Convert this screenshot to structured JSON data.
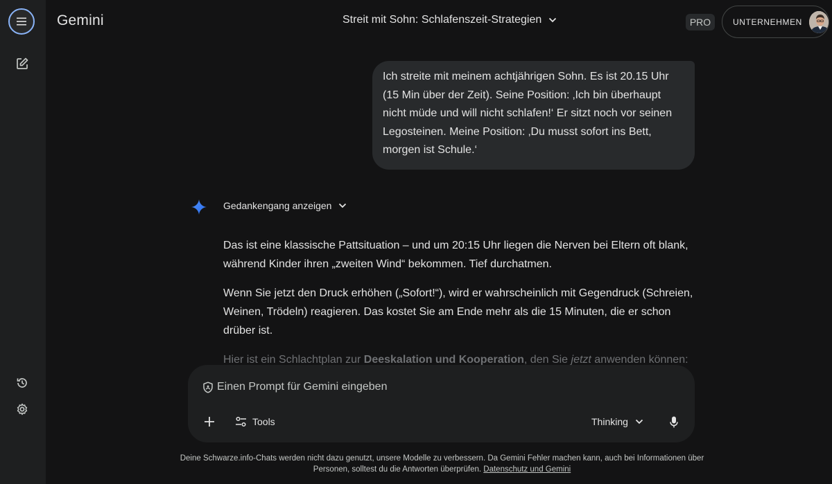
{
  "app": {
    "brand": "Gemini"
  },
  "header": {
    "chat_title": "Streit mit Sohn: Schlafenszeit-Strategien",
    "pro_badge": "PRO",
    "account_label": "UNTERNEHMEN"
  },
  "sidebar": {
    "icons": [
      "menu-icon",
      "new-chat-icon",
      "history-icon",
      "settings-icon"
    ]
  },
  "conversation": {
    "user_message": "Ich streite mit meinem achtjährigen Sohn. Es ist 20.15 Uhr (15 Min über der Zeit). Seine Position: ‚Ich bin überhaupt nicht müde und will nicht schlafen!‘ Er sitzt noch vor seinen Legosteinen. Meine Position: ‚Du musst sofort ins Bett, morgen ist Schule.‘",
    "show_thinking": "Gedankengang anzeigen",
    "response_p1": "Das ist eine klassische Pattsituation – und um 20:15 Uhr liegen die Nerven bei Eltern oft blank, während Kinder ihren „zweiten Wind“ bekommen. Tief durchatmen.",
    "response_p2": "Wenn Sie jetzt den Druck erhöhen („Sofort!“), wird er wahrscheinlich mit Gegendruck (Schreien, Weinen, Trödeln) reagieren. Das kostet Sie am Ende mehr als die 15 Minuten, die er schon drüber ist.",
    "response_p3": {
      "pre": "Hier ist ein Schlachtplan zur ",
      "bold": "Deeskalation und Kooperation",
      "mid": ", den Sie ",
      "italic": "jetzt",
      "post": " anwenden können:"
    }
  },
  "prompt": {
    "placeholder": "Einen Prompt für Gemini eingeben",
    "value": "",
    "tools_label": "Tools",
    "model_label": "Thinking"
  },
  "footer": {
    "text": "Deine Schwarze.info-Chats werden nicht dazu genutzt, unsere Modelle zu verbessern. Da Gemini Fehler machen kann, auch bei Informationen über Personen, solltest du die Antworten überprüfen.",
    "link": "Datenschutz und Gemini"
  },
  "colors": {
    "background": "#131314",
    "sidebar": "#1e1f20",
    "bubble": "#282a2c",
    "accent": "#8ab4f8",
    "spark_blue": "#4285f4"
  }
}
